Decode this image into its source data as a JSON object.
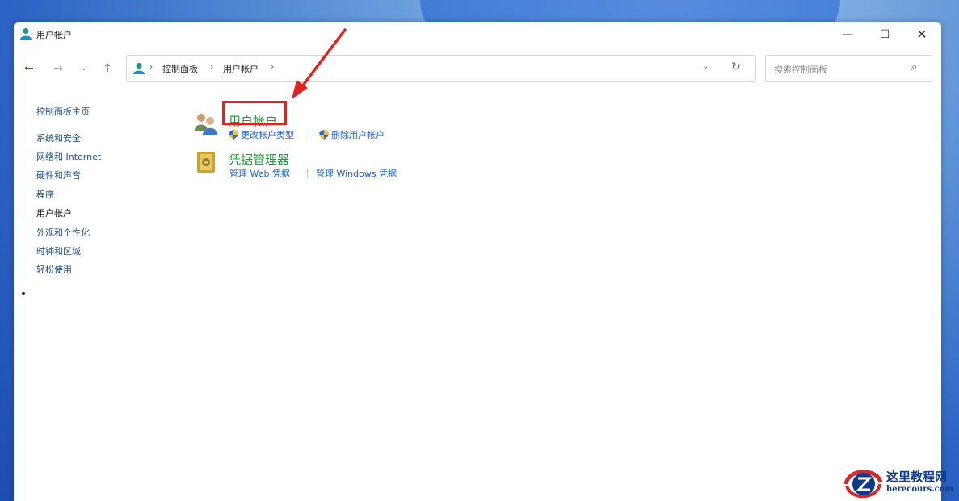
{
  "window": {
    "title": "用户帐户",
    "minimize": "—",
    "maximize": "☐",
    "close": "✕"
  },
  "nav": {
    "back": "←",
    "forward": "→",
    "recent": "⌄",
    "up": "↑",
    "breadcrumb": [
      {
        "label": "控制面板"
      },
      {
        "label": "用户帐户"
      }
    ],
    "sep": "›",
    "dropdown": "⌄",
    "refresh": "↻"
  },
  "search": {
    "placeholder": "搜索控制面板",
    "icon": "⌕"
  },
  "sidebar": {
    "home": "控制面板主页",
    "items": [
      {
        "label": "系统和安全"
      },
      {
        "label": "网络和 Internet"
      },
      {
        "label": "硬件和声音"
      },
      {
        "label": "程序"
      },
      {
        "label": "用户帐户",
        "active": true
      },
      {
        "label": "外观和个性化"
      },
      {
        "label": "时钟和区域"
      },
      {
        "label": "轻松使用"
      }
    ]
  },
  "sections": [
    {
      "title": "用户帐户",
      "links": [
        "更改帐户类型",
        "删除用户帐户"
      ]
    },
    {
      "title": "凭据管理器",
      "links": [
        "管理 Web 凭据",
        "管理 Windows 凭据"
      ]
    }
  ],
  "watermark": {
    "cn": "这里教程网",
    "en": "herecours.com"
  },
  "colors": {
    "accent_green": "#1a9b3a",
    "link_blue": "#1f64c8",
    "annotation_red": "#e0231e"
  }
}
